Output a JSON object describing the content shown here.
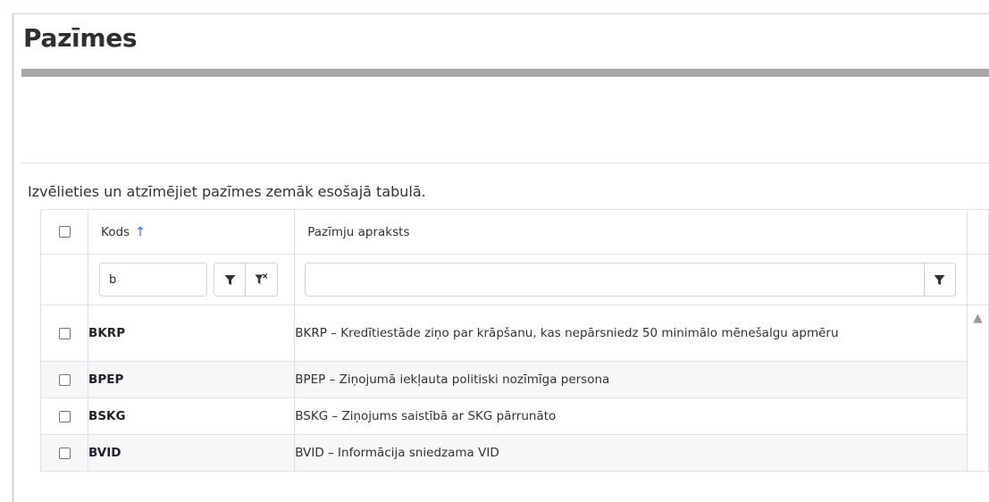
{
  "page": {
    "title": "Pazīmes",
    "instruction": "Izvēlieties un atzīmējiet pazīmes zemāk esošajā tabulā."
  },
  "table": {
    "columns": [
      {
        "label": "Kods",
        "sorted": "ascending",
        "sort_icon": "sort-arrow-up"
      },
      {
        "label": "Pazīmju apraksts"
      }
    ],
    "filters": {
      "code_value": "b",
      "description_value": ""
    },
    "rows": [
      {
        "code": "BKRP",
        "description": "BKRP – Kredītiestāde ziņo par krāpšanu, kas nepārsniedz 50 minimālo mēnešalgu apmēru",
        "checked": false
      },
      {
        "code": "BPEP",
        "description": "BPEP – Ziņojumā iekļauta politiski nozīmīga persona",
        "checked": false
      },
      {
        "code": "BSKG",
        "description": "BSKG – Ziņojums saistībā ar SKG pārrunāto",
        "checked": false
      },
      {
        "code": "BVID",
        "description": "BVID – Informācija sniedzama VID",
        "checked": false
      }
    ]
  },
  "colors": {
    "accent": "#1a73e8",
    "title_bar": "#a9a9a9",
    "alt_row": "#f7f7f7"
  }
}
